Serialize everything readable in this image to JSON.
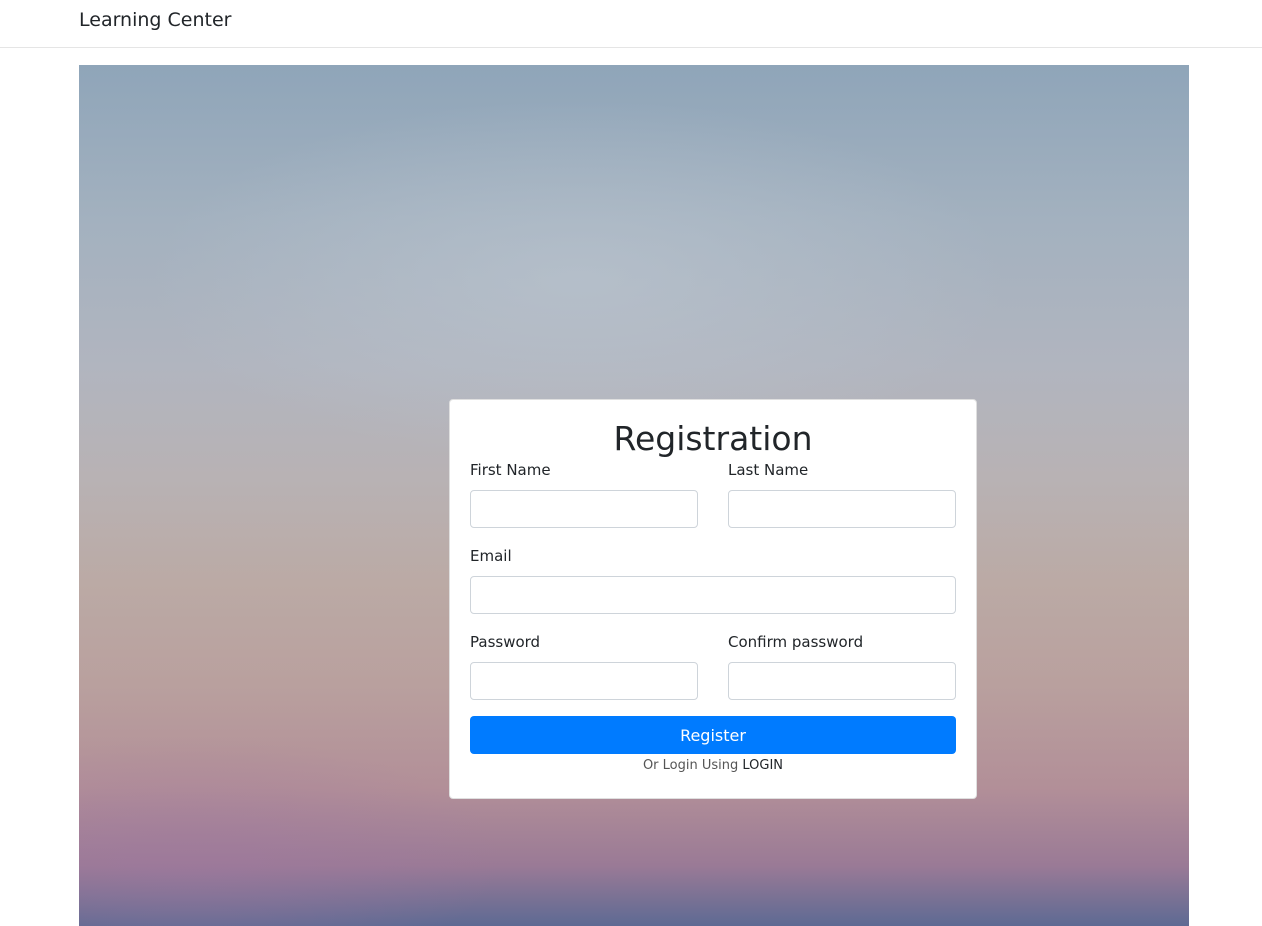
{
  "navbar": {
    "brand": "Learning Center"
  },
  "form": {
    "title": "Registration",
    "fields": {
      "first_name": {
        "label": "First Name",
        "value": "",
        "placeholder": ""
      },
      "last_name": {
        "label": "Last Name",
        "value": "",
        "placeholder": ""
      },
      "email": {
        "label": "Email",
        "value": "",
        "placeholder": ""
      },
      "password": {
        "label": "Password",
        "value": "",
        "placeholder": ""
      },
      "confirm_password": {
        "label": "Confirm password",
        "value": "",
        "placeholder": ""
      }
    },
    "submit_label": "Register",
    "alt_prefix": "Or Login Using",
    "alt_link": "LOGIN"
  },
  "colors": {
    "primary_button": "#007bff",
    "card_background": "#ffffff",
    "navbar_border": "#e5e5e5"
  }
}
